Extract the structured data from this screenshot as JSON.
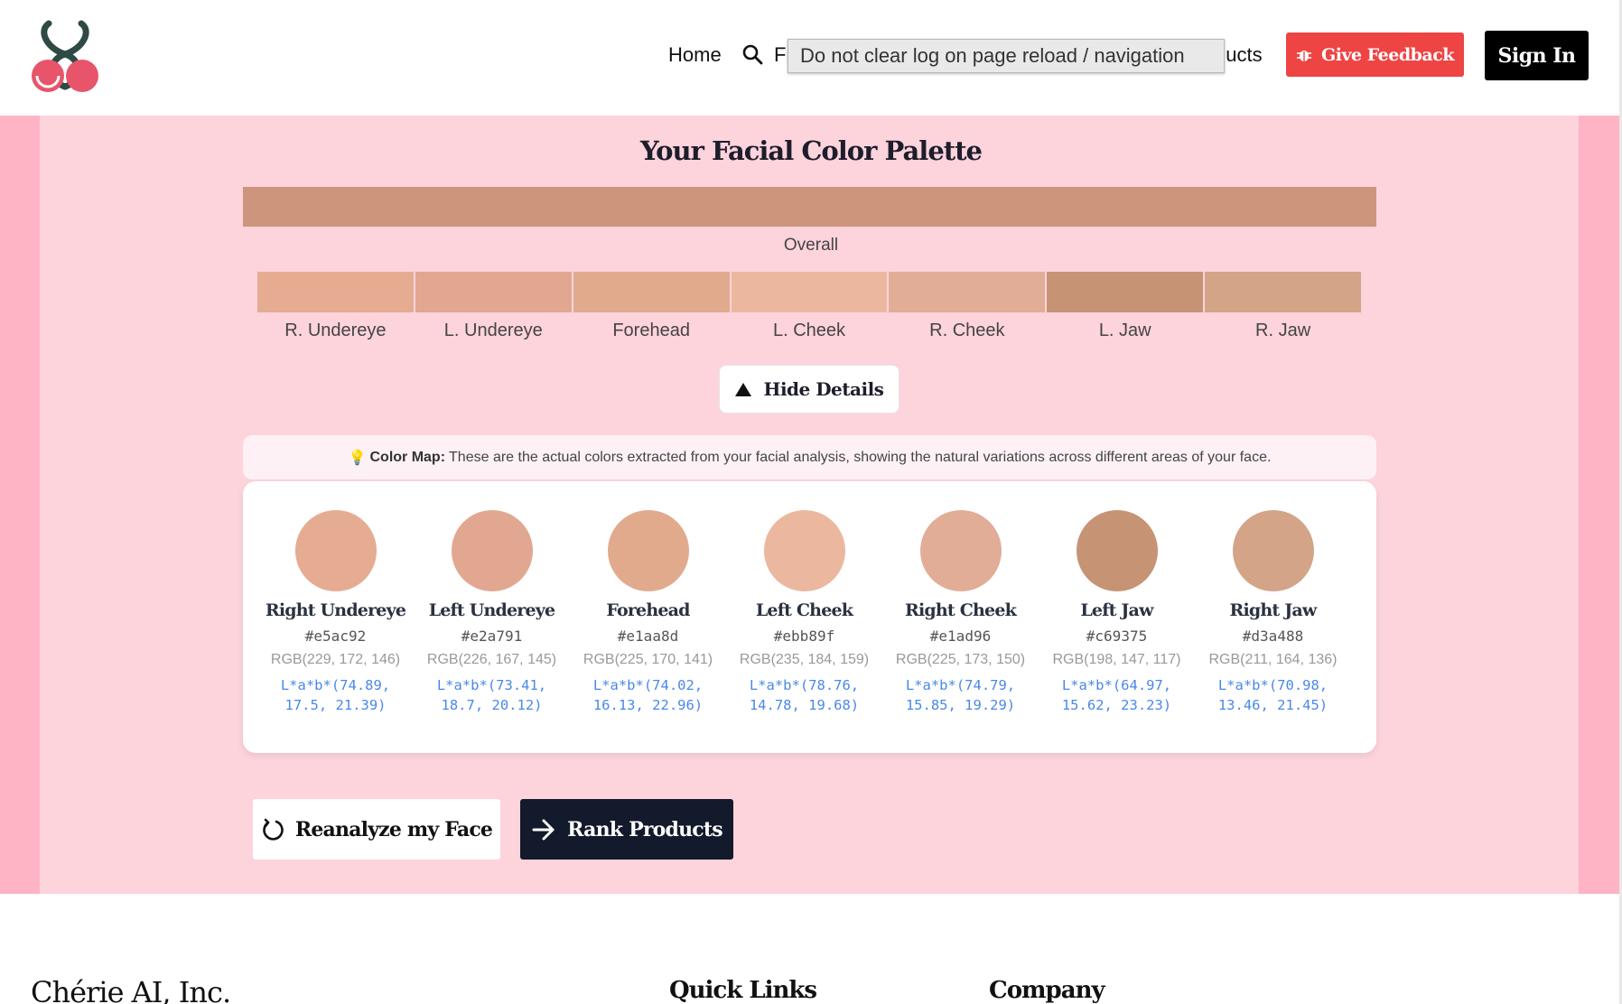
{
  "header": {
    "nav_home": "Home",
    "nav_find": "Fi",
    "nav_products": "ducts",
    "tooltip": "Do not clear log on page reload / navigation",
    "feedback_label": "Give Feedback",
    "signin_label": "Sign In",
    "brand_color": "#ee4444"
  },
  "palette": {
    "title": "Your Facial Color Palette",
    "overall_color": "#cc957c",
    "overall_label": "Overall",
    "regions": [
      {
        "label": "R. Undereye",
        "color": "#e5ac92"
      },
      {
        "label": "L. Undereye",
        "color": "#e2a791"
      },
      {
        "label": "Forehead",
        "color": "#e1aa8d"
      },
      {
        "label": "L. Cheek",
        "color": "#ebb89f"
      },
      {
        "label": "R. Cheek",
        "color": "#e1ad96"
      },
      {
        "label": "L. Jaw",
        "color": "#c69375"
      },
      {
        "label": "R. Jaw",
        "color": "#d3a488"
      }
    ],
    "toggle_label": "Hide Details"
  },
  "colormap": {
    "heading": "Color Map:",
    "text": "These are the actual colors extracted from your facial analysis, showing the natural variations across different areas of your face."
  },
  "details": [
    {
      "name": "Right Undereye",
      "hex": "#e5ac92",
      "rgb": "RGB(229, 172, 146)",
      "lab1": "L*a*b*(74.89,",
      "lab2": "17.5, 21.39)"
    },
    {
      "name": "Left Undereye",
      "hex": "#e2a791",
      "rgb": "RGB(226, 167, 145)",
      "lab1": "L*a*b*(73.41,",
      "lab2": "18.7, 20.12)"
    },
    {
      "name": "Forehead",
      "hex": "#e1aa8d",
      "rgb": "RGB(225, 170, 141)",
      "lab1": "L*a*b*(74.02,",
      "lab2": "16.13, 22.96)"
    },
    {
      "name": "Left Cheek",
      "hex": "#ebb89f",
      "rgb": "RGB(235, 184, 159)",
      "lab1": "L*a*b*(78.76,",
      "lab2": "14.78, 19.68)"
    },
    {
      "name": "Right Cheek",
      "hex": "#e1ad96",
      "rgb": "RGB(225, 173, 150)",
      "lab1": "L*a*b*(74.79,",
      "lab2": "15.85, 19.29)"
    },
    {
      "name": "Left Jaw",
      "hex": "#c69375",
      "rgb": "RGB(198, 147, 117)",
      "lab1": "L*a*b*(64.97,",
      "lab2": "15.62, 23.23)"
    },
    {
      "name": "Right Jaw",
      "hex": "#d3a488",
      "rgb": "RGB(211, 164, 136)",
      "lab1": "L*a*b*(70.98,",
      "lab2": "13.46, 21.45)"
    }
  ],
  "actions": {
    "reanalyze_label": "Reanalyze my Face",
    "rank_label": "Rank Products"
  },
  "footer": {
    "company_name": "Chérie AI, Inc.",
    "quick_links": "Quick Links",
    "company": "Company"
  }
}
